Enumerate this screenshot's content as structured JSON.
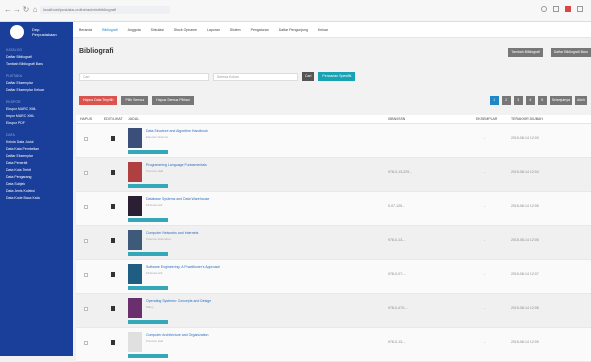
{
  "browser": {
    "back": "←",
    "forward": "→",
    "reload": "↻",
    "home": "⌂",
    "url": "localhost/pustaka-online/admin/bibliografi"
  },
  "sidebar": {
    "brand_line1": "Dep.",
    "brand_line2": "Perpustakaan",
    "sections": [
      {
        "label": "KATALOG",
        "items": [
          "Daftar Bibliografi",
          "Tambah Bibliografi Baru"
        ]
      },
      {
        "label": "PUSTAKA",
        "items": [
          "Daftar Eksemplar",
          "Daftar Eksemplar Keluar"
        ]
      },
      {
        "label": "EKSPOR",
        "items": [
          "Ekspor MARC XML",
          "Impor MARC XML",
          "Ekspor PDF"
        ]
      },
      {
        "label": "DATA",
        "items": [
          "Kelola Data Judul",
          "Data Kata Pembelian",
          "Daftar Eksemplar",
          "Data Penerbit",
          "Data Kota Terbit",
          "Data Pengarang",
          "Data Subjek",
          "Data Jenis Koleksi",
          "Data Kode Baca Kata"
        ]
      }
    ]
  },
  "topnav": {
    "items": [
      "Beranda",
      "Bibliografi",
      "Anggota",
      "Sirkulasi",
      "Stock Opname",
      "Laporan",
      "Sistem",
      "Pengaturan",
      "Daftar Pengunjung",
      "Keluar"
    ],
    "active_index": 1
  },
  "header": {
    "title": "Bibliografi",
    "btn_add": "Tambah Bibliografi",
    "btn_list": "Daftar Bibliografi Baru"
  },
  "filters": {
    "search_placeholder": "Cari",
    "field_select": "Semua Kolom",
    "search_button": "Cari",
    "advanced_button": "Pencarian Spesifik"
  },
  "actions": {
    "delete": "Hapus Data Terpilih",
    "select_all": "Pilih Semua",
    "unselect_all": "Hapus Semua Pilihan"
  },
  "pagination": {
    "pages": [
      "1",
      "2",
      "3",
      "4",
      "5"
    ],
    "active": "1",
    "next": "Selanjutnya",
    "last": "Akhir"
  },
  "table": {
    "headers": [
      "HAPUS",
      "EDIT/LIHAT",
      "JUDUL",
      "ISBN/ISSN",
      "EKSEMPLAR",
      "TERAKHIR DIUBAH"
    ],
    "rows": [
      {
        "title": "Data Structure and Algorithm Handbook",
        "subtitle": "Elsevier Science",
        "isbn": "",
        "copies": "-",
        "updated": "2015-08-14 12:03",
        "cover": "#3a4f7a"
      },
      {
        "title": "Programming Language Fundamentals",
        "subtitle": "Prentice Hall",
        "isbn": "978-0-13-229...",
        "copies": "-",
        "updated": "2015-08-14 12:04",
        "cover": "#b04040"
      },
      {
        "title": "Database Systems and Data Warehouse",
        "subtitle": "McGraw-Hill",
        "isbn": "0-07-125...",
        "copies": "-",
        "updated": "2015-08-14 12:05",
        "cover": "#2a1f33"
      },
      {
        "title": "Computer Networks and Internets",
        "subtitle": "Pearson Education",
        "isbn": "978-0-13-...",
        "copies": "-",
        "updated": "2015-08-14 12:06",
        "cover": "#3d5a78"
      },
      {
        "title": "Software Engineering: A Practitioner's Approach",
        "subtitle": "McGraw-Hill",
        "isbn": "978-0-07-...",
        "copies": "-",
        "updated": "2015-08-14 12:07",
        "cover": "#1f5e82"
      },
      {
        "title": "Operating Systems: Concepts and Design",
        "subtitle": "Wiley",
        "isbn": "978-0-470-...",
        "copies": "-",
        "updated": "2015-08-14 12:08",
        "cover": "#6a2f6f"
      },
      {
        "title": "Computer Architecture and Organization",
        "subtitle": "Prentice Hall",
        "isbn": "978-0-13-...",
        "copies": "-",
        "updated": "2015-08-14 12:09",
        "cover": "#e0e0e0"
      }
    ]
  },
  "colors": {
    "sidebar": "#1a3f9a",
    "accent": "#1f86c8",
    "danger": "#d9534f",
    "teal": "#18a3b4",
    "neutral": "#777777"
  }
}
